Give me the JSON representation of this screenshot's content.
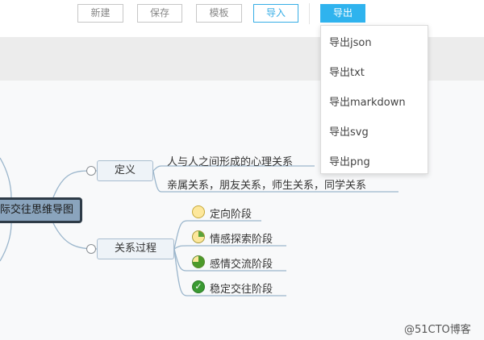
{
  "toolbar": {
    "new_label": "新建",
    "save_label": "保存",
    "template_label": "模板",
    "import_label": "导入",
    "export_label": "导出"
  },
  "export_menu": {
    "items": [
      "导出json",
      "导出txt",
      "导出markdown",
      "导出svg",
      "导出png"
    ]
  },
  "mindmap": {
    "root": "际交往思维导图",
    "branches": [
      {
        "label": "定义",
        "children": [
          "人与人之间形成的心理关系",
          "亲属关系，朋友关系，师生关系，同学关系"
        ]
      },
      {
        "label": "关系过程",
        "children": [
          {
            "text": "定向阶段",
            "priority_icon": "progress-0-icon"
          },
          {
            "text": "情感探索阶段",
            "priority_icon": "progress-25-icon"
          },
          {
            "text": "感情交流阶段",
            "priority_icon": "progress-75-icon"
          },
          {
            "text": "稳定交往阶段",
            "priority_icon": "progress-complete-icon"
          }
        ]
      }
    ]
  },
  "watermark": "@51CTO博客",
  "colors": {
    "accent": "#2fb3ee",
    "node_bg": "#eef3f8",
    "root_bg": "#8aa4bd",
    "link": "#9bb6cc"
  }
}
